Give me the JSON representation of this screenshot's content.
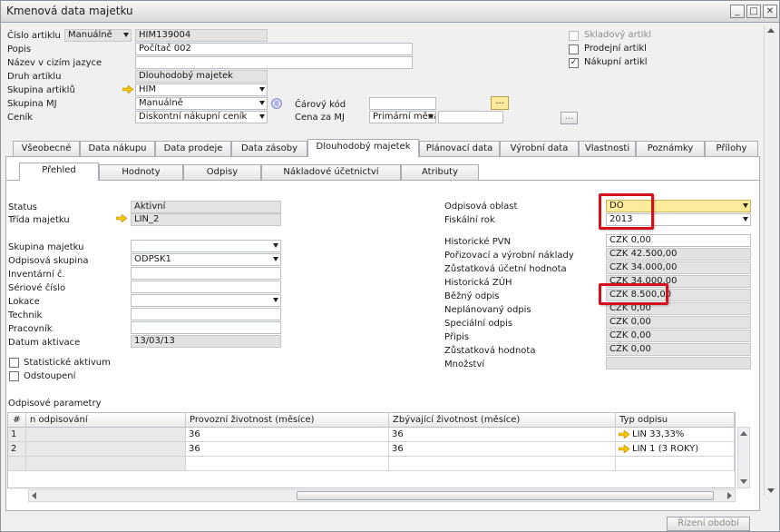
{
  "window": {
    "title": "Kmenová data majetku",
    "min": "_",
    "max": "□",
    "close": "✕"
  },
  "header": {
    "cislo_artiklu_label": "Číslo artiklu",
    "cislo_artiklu_mode": "Manuálně",
    "cislo_artiklu_value": "HIM139004",
    "popis_label": "Popis",
    "popis_value": "Počítač 002",
    "nazev_cizi_label": "Název v cizím jazyce",
    "nazev_cizi_value": "",
    "druh_label": "Druh artiklu",
    "druh_value": "Dlouhodobý majetek",
    "skupina_art_label": "Skupina artiklů",
    "skupina_art_value": "HIM",
    "skupina_mj_label": "Skupina MJ",
    "skupina_mj_value": "Manuálně",
    "cenik_label": "Ceník",
    "cenik_value": "Diskontní nákupní ceník",
    "carovy_kod_label": "Čárový kód",
    "carovy_kod_value": "",
    "carovy_btn": "...",
    "cena_mj_label": "Cena za MJ",
    "cena_mj_select": "Primární měna",
    "cena_mj_value": "",
    "cena_btn": "...",
    "skladovy_label": "Skladový artikl",
    "prodejni_label": "Prodejní artikl",
    "nakupni_label": "Nákupní artikl",
    "nakupni_checked": "✓"
  },
  "tabs": [
    "Všeobecné",
    "Data nákupu",
    "Data prodeje",
    "Data zásoby",
    "Dlouhodobý majetek",
    "Plánovací data",
    "Výrobní data",
    "Vlastnosti",
    "Poznámky",
    "Přílohy"
  ],
  "subtabs": [
    "Přehled",
    "Hodnoty",
    "Odpisy",
    "Nákladové účetnictví",
    "Atributy"
  ],
  "left": {
    "status_label": "Status",
    "status_value": "Aktivní",
    "trida_label": "Třída majetku",
    "trida_value": "LIN_2",
    "skupina_label": "Skupina majetku",
    "skupina_value": "",
    "odpisova_label": "Odpisová skupina",
    "odpisova_value": "ODPSK1",
    "inventarni_label": "Inventární č.",
    "inventarni_value": "",
    "seriove_label": "Sériové číslo",
    "seriove_value": "",
    "lokace_label": "Lokace",
    "lokace_value": "",
    "technik_label": "Technik",
    "technik_value": "",
    "pracovnik_label": "Pracovník",
    "pracovnik_value": "",
    "datum_label": "Datum aktivace",
    "datum_value": "13/03/13",
    "statisticke_label": "Statistické aktivum",
    "odstoupeni_label": "Odstoupení"
  },
  "right": {
    "oblast_label": "Odpisová oblast",
    "oblast_value": "DO",
    "rok_label": "Fiskální rok",
    "rok_value": "2013",
    "hist_pvn_label": "Historické PVN",
    "hist_pvn_value": "CZK 0,00",
    "poriz_label": "Pořizovací a výrobní náklady",
    "poriz_value": "CZK 42.500,00",
    "zustatkova_ucetni_label": "Zůstatková účetní hodnota",
    "zustatkova_ucetni_value": "CZK 34.000,00",
    "hist_zuh_label": "Historická ZÚH",
    "hist_zuh_value": "CZK 34.000,00",
    "bezny_label": "Běžný odpis",
    "bezny_value": "CZK 8.500,00",
    "neplan_label": "Neplánovaný odpis",
    "neplan_value": "CZK 0,00",
    "special_label": "Speciální odpis",
    "special_value": "CZK 0,00",
    "pripis_label": "Připis",
    "pripis_value": "CZK 0,00",
    "zustatkova_label": "Zůstatková hodnota",
    "zustatkova_value": "CZK 0,00",
    "mnozstvi_label": "Množství",
    "mnozstvi_value": ""
  },
  "params": {
    "title": "Odpisové parametry",
    "columns": [
      "#",
      "n odpisování",
      "Provozní životnost (měsíce)",
      "Zbývající životnost (měsíce)",
      "Typ odpisu"
    ],
    "rows": [
      {
        "num": "1",
        "area": "",
        "provozni": "36",
        "zbyvajici": "36",
        "typ": "LIN 33,33%"
      },
      {
        "num": "2",
        "area": "",
        "provozni": "36",
        "zbyvajici": "36",
        "typ": "LIN 1 (3 ROKY)"
      }
    ]
  },
  "footer": {
    "rizeni_btn": "Řízení období"
  },
  "colors": {
    "highlight": "#d5101c",
    "yellow_field": "#fbeb9a",
    "arrow": "#f5c400"
  }
}
